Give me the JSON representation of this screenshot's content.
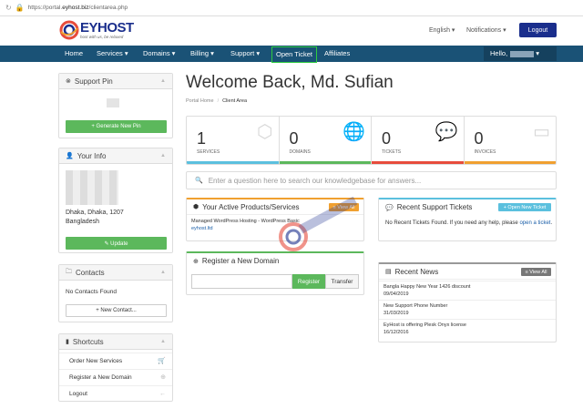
{
  "browser": {
    "url_prefix": "https://portal.",
    "url_domain": "eyhost.biz",
    "url_path": "/clientarea.php"
  },
  "header": {
    "logo_text": "EYHOST",
    "logo_tagline": "host with us, be relaxed",
    "language": "English",
    "notifications": "Notifications",
    "logout": "Logout"
  },
  "nav": {
    "items": [
      "Home",
      "Services",
      "Domains",
      "Billing",
      "Support",
      "Open Ticket",
      "Affiliates"
    ],
    "hello": "Hello,"
  },
  "sidebar": {
    "support_pin": {
      "title": "Support Pin",
      "button": "+ Generate New Pin"
    },
    "your_info": {
      "title": "Your Info",
      "address_line": "Dhaka, Dhaka, 1207",
      "country": "Bangladesh",
      "button": "✎ Update"
    },
    "contacts": {
      "title": "Contacts",
      "empty": "No Contacts Found",
      "button": "+ New Contact..."
    },
    "shortcuts": {
      "title": "Shortcuts",
      "items": [
        "Order New Services",
        "Register a New Domain",
        "Logout"
      ]
    }
  },
  "main": {
    "welcome": "Welcome Back, Md. Sufian",
    "breadcrumb": [
      "Portal Home",
      "Client Area"
    ],
    "stats": [
      {
        "value": "1",
        "label": "SERVICES",
        "color": "#5bc0de"
      },
      {
        "value": "0",
        "label": "DOMAINS",
        "color": "#5cb85c"
      },
      {
        "value": "0",
        "label": "TICKETS",
        "color": "#e74c3c"
      },
      {
        "value": "0",
        "label": "INVOICES",
        "color": "#f0a030"
      }
    ],
    "kb_placeholder": "Enter a question here to search our knowledgebase for answers...",
    "products": {
      "title": "Your Active Products/Services",
      "button": "≡ View All",
      "item_line1": "Managed WordPress Hosting - WordPress Basic",
      "item_line2": "eyhost.ltd"
    },
    "register_domain": {
      "title": "Register a New Domain",
      "register": "Register",
      "transfer": "Transfer"
    },
    "tickets": {
      "title": "Recent Support Tickets",
      "button": "+ Open New Ticket",
      "text_line1": "No Recent Tickets Found. If you need any help, please",
      "link_open": "open a",
      "link_ticket": "ticket",
      "text_end": "."
    },
    "news": {
      "title": "Recent News",
      "button": "≡ View All",
      "items": [
        {
          "title": "Bangla Happy New Year 1426 discount",
          "date": "09/04/2019"
        },
        {
          "title": "New Support Phone Number",
          "date": "31/03/2019"
        },
        {
          "title": "EyHost is offering Plesk Onyx license",
          "date": "16/12/2016"
        }
      ]
    }
  },
  "colors": {
    "nav": "#1a5276",
    "brand": "#1a2e8c",
    "green": "#5cb85c",
    "orange": "#f0a030"
  }
}
